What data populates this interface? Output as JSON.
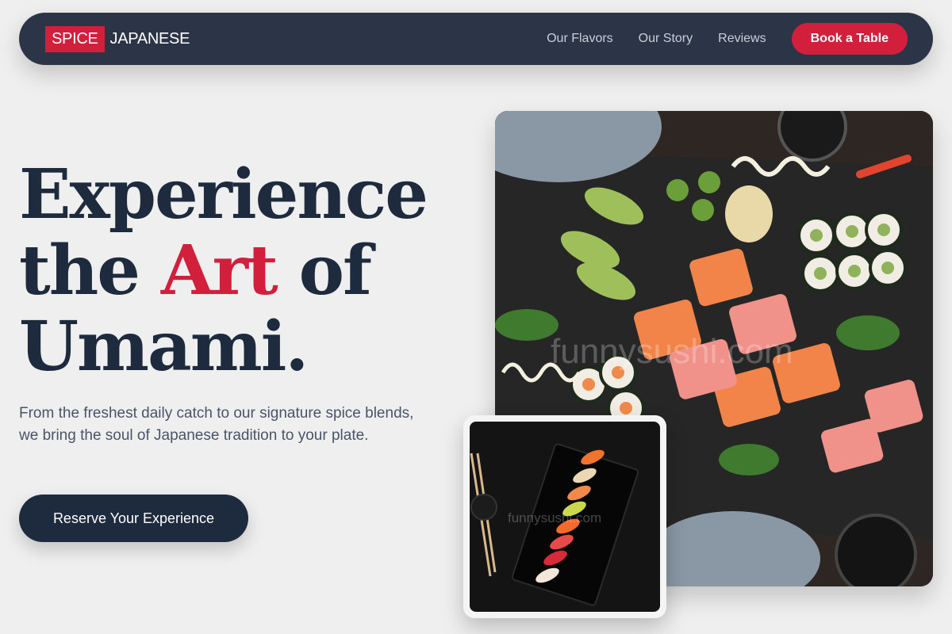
{
  "brand": {
    "part1": "SPICE",
    "part2": "JAPANESE"
  },
  "nav": {
    "links": [
      "Our Flavors",
      "Our Story",
      "Reviews"
    ],
    "cta": "Book a Table"
  },
  "hero": {
    "title_line1": "Experience",
    "title_line2_a": "the ",
    "title_line2_accent": "Art",
    "title_line2_b": " of",
    "title_line3": "Umami.",
    "subtitle": "From the freshest daily catch to our signature spice blends, we bring the soul of Japanese tradition to your plate.",
    "cta": "Reserve Your Experience"
  },
  "images": {
    "main_watermark": "funnysushi.com",
    "small_watermark": "funnysushi.com"
  },
  "colors": {
    "accent": "#d21f3c",
    "navy": "#1e2a3e",
    "nav_bg": "#2c3547",
    "page_bg": "#efefef"
  }
}
